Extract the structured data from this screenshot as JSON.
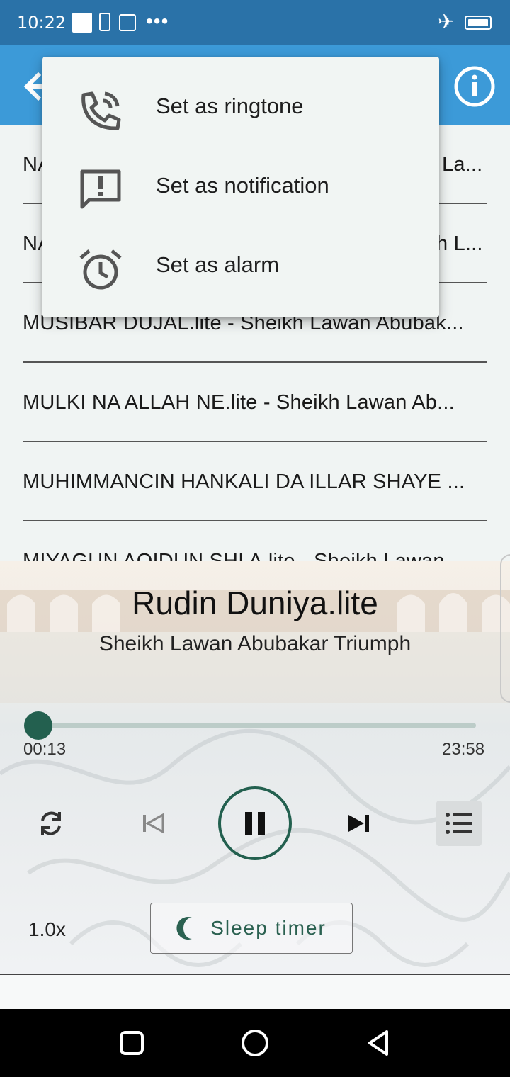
{
  "status_bar": {
    "time": "10:22"
  },
  "list": {
    "items": [
      {
        "label": "NA",
        "label_right": "La..."
      },
      {
        "label": "NA",
        "label_right": "h L..."
      },
      {
        "label": "MUSIBAR DUJAL.lite - Sheikh Lawan Abubak..."
      },
      {
        "label": "MULKI NA ALLAH NE.lite - Sheikh Lawan Ab..."
      },
      {
        "label": "MUHIMMANCIN HANKALI DA ILLAR SHAYE ..."
      },
      {
        "label": "MIYAGUN AQIDUN SHI A.lite - Sheikh Lawan"
      }
    ]
  },
  "menu": {
    "items": [
      {
        "label": "Set as ringtone",
        "icon": "phone-ring-icon"
      },
      {
        "label": "Set as notification",
        "icon": "notification-alert-icon"
      },
      {
        "label": "Set as alarm",
        "icon": "alarm-clock-icon"
      }
    ]
  },
  "player": {
    "title": "Rudin Duniya.lite",
    "artist": "Sheikh Lawan Abubakar Triumph",
    "elapsed": "00:13",
    "duration": "23:58",
    "progress_fraction": 0.009,
    "speed": "1.0x",
    "sleep_timer_label": "Sleep timer",
    "accent_color": "#23604f"
  },
  "colors": {
    "status_bar": "#2a72a8",
    "app_bar": "#3c9ad8",
    "background": "#f0f4f3"
  }
}
